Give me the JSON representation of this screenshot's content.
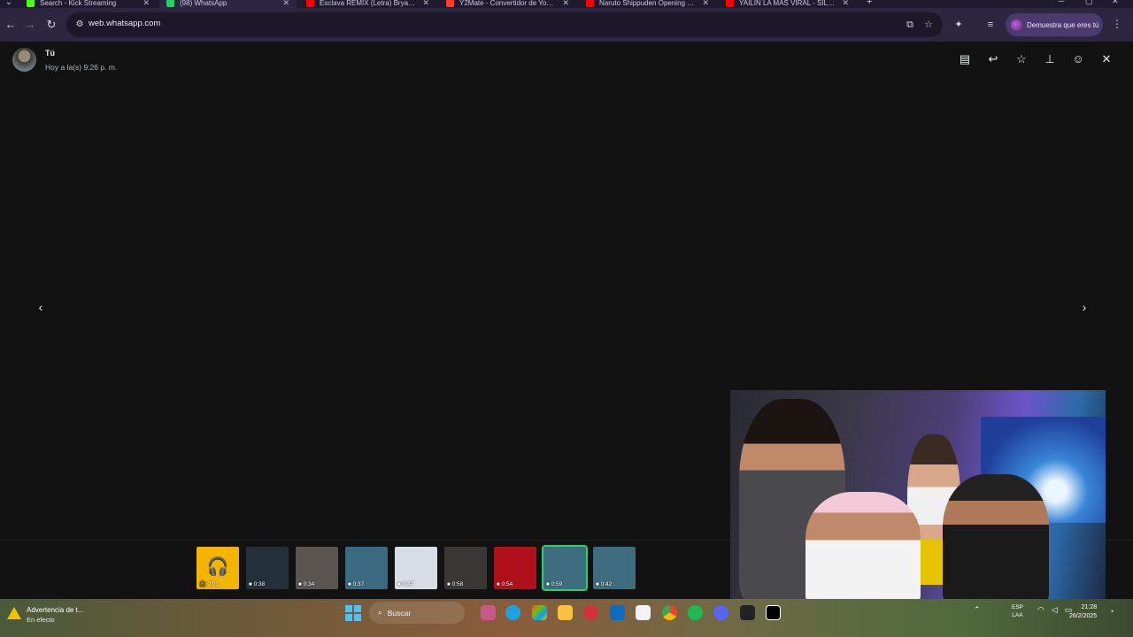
{
  "browser": {
    "tabs": [
      {
        "title": "Search - Kick Streaming",
        "color": "#53fc18",
        "active": false
      },
      {
        "title": "(98) WhatsApp",
        "color": "#25d366",
        "active": true
      },
      {
        "title": "Esclava REMIX (Letra) Bryant M...",
        "color": "#ff0000",
        "active": false
      },
      {
        "title": "Y2Mate - Convertidor de YouTu...",
        "color": "#ff3b30",
        "active": false
      },
      {
        "title": "Naruto Shippuden Opening 3 |...",
        "color": "#ff0000",
        "active": false
      },
      {
        "title": "YAILIN LA MAS VIRAL - SILLA (...",
        "color": "#ff0000",
        "active": false
      }
    ],
    "url": "web.whatsapp.com",
    "profile_label": "Demuestra que eres tú"
  },
  "viewer": {
    "sender_name": "Tú",
    "timestamp": "Hoy a la(s) 9:26 p. m.",
    "tool_icons": [
      "message-icon",
      "reply-icon",
      "star-icon",
      "pin-icon",
      "emoji-icon",
      "close-icon"
    ],
    "prev_label": "‹",
    "next_label": "›"
  },
  "thumbnails": [
    {
      "kind": "audio",
      "duration": "0:01",
      "bg": "#f5b400",
      "selected": false
    },
    {
      "kind": "video",
      "duration": "0:38",
      "bg": "#24303a",
      "selected": false
    },
    {
      "kind": "video",
      "duration": "0:34",
      "bg": "#5a5550",
      "selected": false
    },
    {
      "kind": "video",
      "duration": "0:37",
      "bg": "#3c6a80",
      "selected": false
    },
    {
      "kind": "video",
      "duration": "0:47",
      "bg": "#d8dde6",
      "selected": false
    },
    {
      "kind": "video",
      "duration": "0:58",
      "bg": "#3a3836",
      "selected": false
    },
    {
      "kind": "video",
      "duration": "0:54",
      "bg": "#b0101a",
      "selected": false
    },
    {
      "kind": "video",
      "duration": "0:59",
      "bg": "#3e6d80",
      "selected": true
    },
    {
      "kind": "video",
      "duration": "0:42",
      "bg": "#3e6d80",
      "selected": false
    }
  ],
  "taskbar": {
    "warning_title": "Advertencia de t...",
    "warning_sub": "En efecto",
    "search_placeholder": "Buscar",
    "lang_top": "ESP",
    "lang_bottom": "LAA",
    "time": "21:28",
    "date": "26/2/2025"
  }
}
